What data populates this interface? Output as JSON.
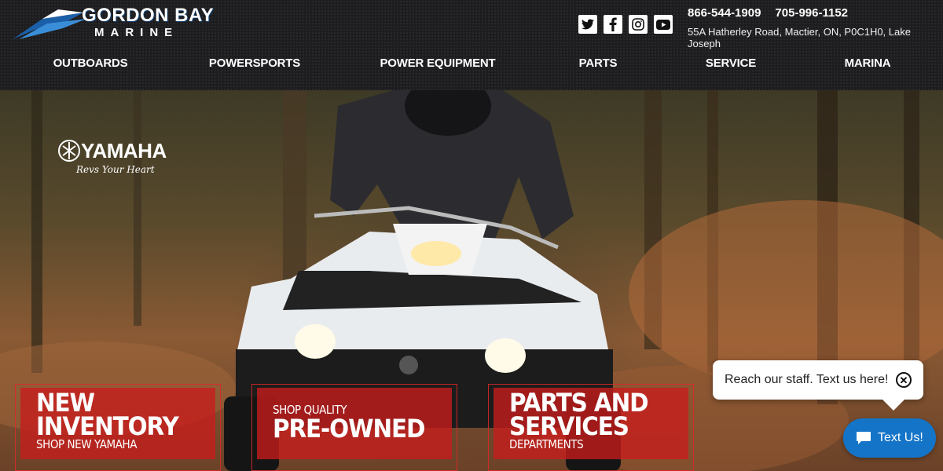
{
  "brand": {
    "name_top": "GORDON BAY",
    "name_bottom": "MARINE"
  },
  "social": [
    "twitter-icon",
    "facebook-icon",
    "instagram-icon",
    "youtube-icon"
  ],
  "contact": {
    "phone1": "866-544-1909",
    "phone2": "705-996-1152",
    "address": "55A Hatherley Road, Mactier, ON, P0C1H0, Lake Joseph"
  },
  "nav": [
    {
      "label": "OUTBOARDS"
    },
    {
      "label": "POWERSPORTS"
    },
    {
      "label": "POWER EQUIPMENT"
    },
    {
      "label": "PARTS"
    },
    {
      "label": "SERVICE"
    },
    {
      "label": "MARINA"
    }
  ],
  "hero": {
    "logo_word": "YAMAHA",
    "logo_tagline": "Revs Your Heart"
  },
  "promos": [
    {
      "line1": "NEW",
      "line2": "INVENTORY",
      "sub": "SHOP NEW YAMAHA"
    },
    {
      "pre": "SHOP QUALITY",
      "big": "PRE-OWNED"
    },
    {
      "line1": "PARTS AND",
      "line2": "SERVICES",
      "sub": "DEPARTMENTS"
    }
  ],
  "chat": {
    "bubble_text": "Reach our staff. Text us here!",
    "button_label": "Text Us!"
  },
  "colors": {
    "header_bg": "#1d1d1f",
    "promo_red": "#c81c1c",
    "chat_blue": "#1474c8",
    "brand_blue": "#0b3a6e"
  }
}
